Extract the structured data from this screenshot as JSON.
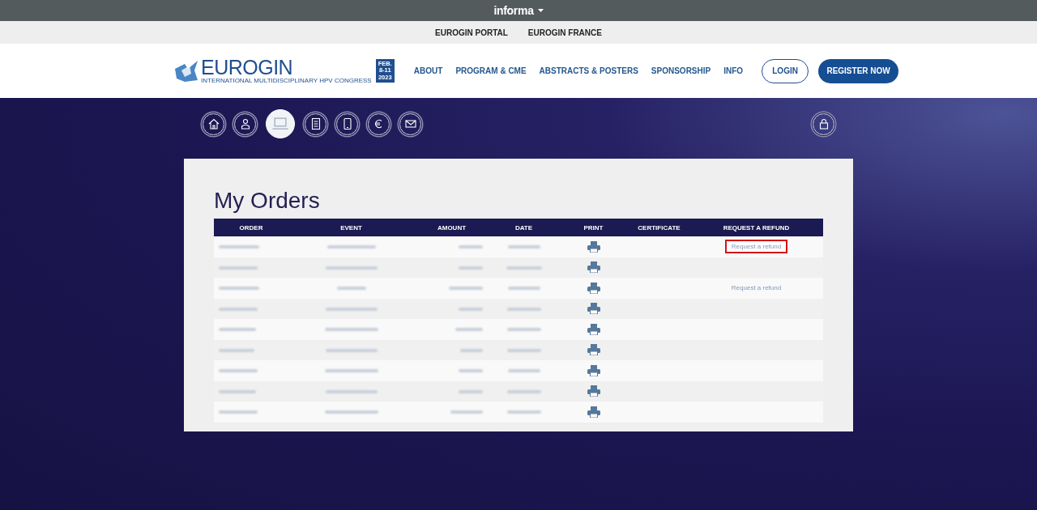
{
  "brand_bar": {
    "label": "informa"
  },
  "portal_bar": {
    "links": [
      "EUROGIN PORTAL",
      "EUROGIN FRANCE"
    ]
  },
  "header": {
    "logo": {
      "name": "EUROGIN",
      "subtitle": "INTERNATIONAL MULTIDISCIPLINARY HPV CONGRESS",
      "date_lines": [
        "FEB.",
        "8-11",
        "2023"
      ]
    },
    "nav": [
      "ABOUT",
      "PROGRAM & CME",
      "ABSTRACTS & POSTERS",
      "SPONSORSHIP",
      "INFO"
    ],
    "login": "LOGIN",
    "register": "REGISTER NOW"
  },
  "account_nav": [
    {
      "kind": "home",
      "selected": false
    },
    {
      "kind": "person",
      "selected": false
    },
    {
      "kind": "laptop",
      "selected": true
    },
    {
      "kind": "document",
      "selected": false
    },
    {
      "kind": "tablet",
      "selected": false
    },
    {
      "kind": "euro",
      "selected": false
    },
    {
      "kind": "mail",
      "selected": false
    }
  ],
  "orders": {
    "title": "My Orders",
    "columns": [
      "ORDER",
      "EVENT",
      "AMOUNT",
      "DATE",
      "PRINT",
      "CERTIFICATE",
      "REQUEST A REFUND"
    ],
    "rows": [
      {
        "refund": "Request a refund",
        "highlighted": true
      },
      {},
      {
        "refund": "Request a refund",
        "highlighted": false
      },
      {},
      {},
      {},
      {},
      {},
      {}
    ]
  }
}
